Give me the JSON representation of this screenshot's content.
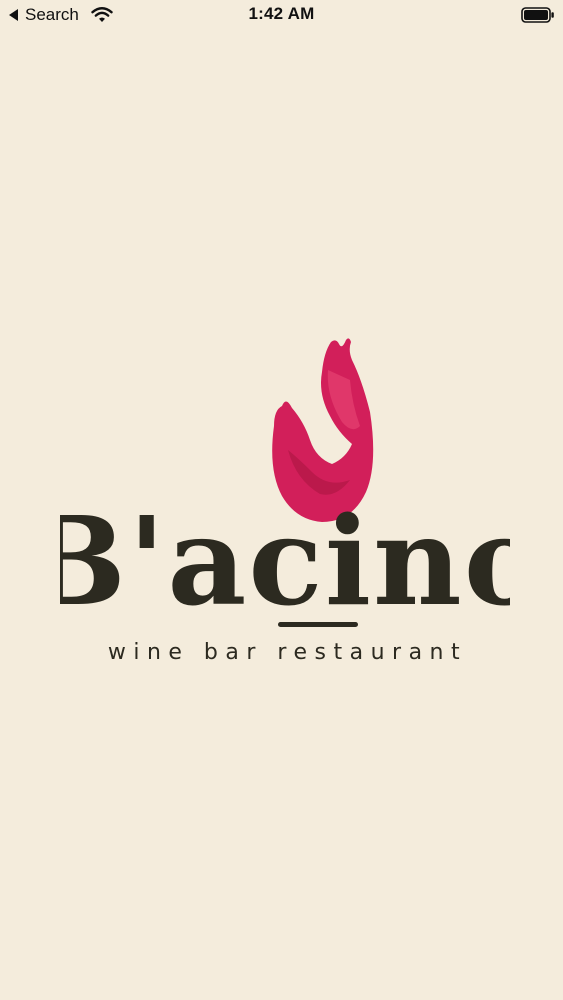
{
  "status_bar": {
    "back_label": "Search",
    "time": "1:42 AM",
    "icons": [
      "back-arrow-icon",
      "wifi-icon",
      "battery-icon"
    ]
  },
  "splash": {
    "brand_logo_text": "B'acino",
    "tagline": "wine bar restaurant",
    "colors": {
      "background": "#f4ecdc",
      "wine": "#d21f5a",
      "wordmark": "#2c2a20"
    }
  }
}
